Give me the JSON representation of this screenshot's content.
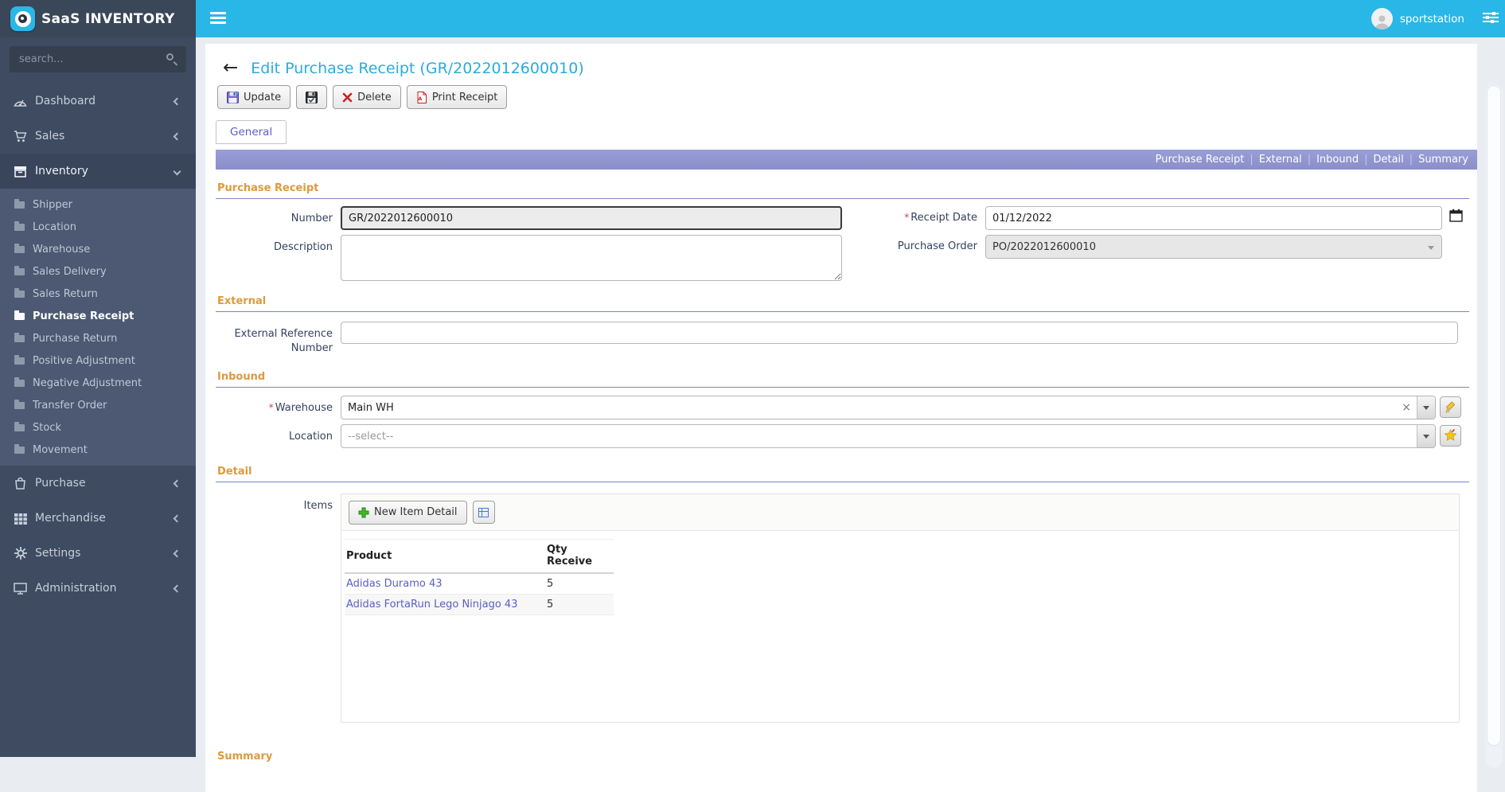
{
  "topbar": {
    "brand": "SaaS INVENTORY",
    "user": "sportstation"
  },
  "sidebar": {
    "search_placeholder": "search...",
    "items": [
      {
        "label": "Dashboard"
      },
      {
        "label": "Sales"
      },
      {
        "label": "Inventory"
      },
      {
        "label": "Purchase"
      },
      {
        "label": "Merchandise"
      },
      {
        "label": "Settings"
      },
      {
        "label": "Administration"
      }
    ],
    "inventory_submenu": [
      "Shipper",
      "Location",
      "Warehouse",
      "Sales Delivery",
      "Sales Return",
      "Purchase Receipt",
      "Purchase Return",
      "Positive Adjustment",
      "Negative Adjustment",
      "Transfer Order",
      "Stock",
      "Movement"
    ],
    "active_item": "Purchase Receipt"
  },
  "page": {
    "title": "Edit Purchase Receipt (GR/2022012600010)",
    "toolbar": {
      "update": "Update",
      "delete": "Delete",
      "print": "Print Receipt"
    },
    "tab": "General",
    "anchor_links": [
      "Purchase Receipt",
      "External",
      "Inbound",
      "Detail",
      "Summary"
    ]
  },
  "form": {
    "purchase_receipt": {
      "heading": "Purchase Receipt",
      "number_label": "Number",
      "number_value": "GR/2022012600010",
      "description_label": "Description",
      "description_value": "",
      "receipt_date_label": "Receipt Date",
      "receipt_date_value": "01/12/2022",
      "purchase_order_label": "Purchase Order",
      "purchase_order_value": "PO/2022012600010"
    },
    "external": {
      "heading": "External",
      "ext_ref_label": "External Reference Number",
      "ext_ref_value": ""
    },
    "inbound": {
      "heading": "Inbound",
      "warehouse_label": "Warehouse",
      "warehouse_value": "Main WH",
      "location_label": "Location",
      "location_placeholder": "--select--"
    },
    "detail": {
      "heading": "Detail",
      "items_label": "Items",
      "new_item_button": "New Item Detail",
      "table": {
        "headers": [
          "Product",
          "Qty Receive"
        ],
        "rows": [
          {
            "product": "Adidas Duramo 43",
            "qty": "5"
          },
          {
            "product": "Adidas FortaRun Lego Ninjago 43",
            "qty": "5"
          }
        ]
      }
    },
    "summary": {
      "heading": "Summary"
    }
  },
  "colors": {
    "topbar": "#29b7e8",
    "sidebar": "#3f4b61",
    "sidebar_submenu": "#4d5972",
    "title_link": "#2aabdf",
    "section_heading": "#dd9a3c",
    "anchor_bar": "#9196d2",
    "table_link": "#5a5fc4"
  }
}
